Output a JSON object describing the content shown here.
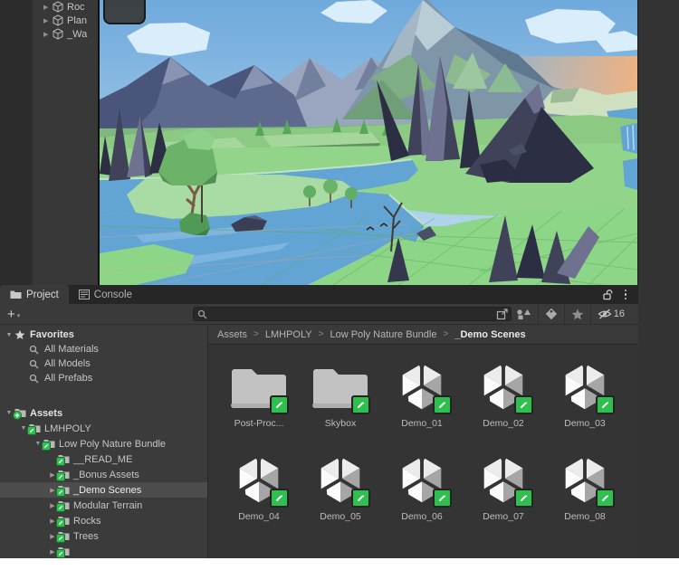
{
  "hierarchy": {
    "items": [
      {
        "label": "Roc"
      },
      {
        "label": "Plan"
      },
      {
        "label": "_Wa"
      }
    ]
  },
  "scene_view": {
    "palette": {
      "sky_top": "#6fa9dc",
      "sky_horizon": "#c3e0f0",
      "sunset": "#f2b27e",
      "cloud": "#d9edfb",
      "mountain_far": "#9aa6bf",
      "mountain_far_shadow": "#73809d",
      "mountain_dark": "#5d6a8e",
      "mountain_dark_shadow": "#49557a",
      "mountain_dark_light": "#8894b1",
      "peak": "#7f96a8",
      "peak_light": "#b9cdd6",
      "peak_green": "#7fae85",
      "cliff_pale": "#cfe0c0",
      "terrain": "#8cc983",
      "terrain_mid": "#92d489",
      "terrain_bright": "#8ed687",
      "island": "#a9dba5",
      "terrace_face": "#6f9e66",
      "water": "#62a4d4",
      "water_light": "#7cb5e0",
      "shore": "#bfe4c0",
      "crystal": "#3f4259",
      "crystal_light": "#6e7290",
      "crystal_dark": "#2c2e44",
      "tree": "#6db269",
      "tree_light": "#8ed18a",
      "tree_dark": "#4e8f52",
      "trunk": "#7a5a42",
      "grid_line": "#5fae63",
      "water_grid": "#d8a390"
    }
  },
  "project_panel": {
    "tabs": [
      {
        "label": "Project",
        "active": true
      },
      {
        "label": "Console",
        "active": false
      }
    ],
    "toolbar": {
      "create_label": "+",
      "search_placeholder": "",
      "hidden_count": "16"
    },
    "favorites": {
      "label": "Favorites",
      "items": [
        "All Materials",
        "All Models",
        "All Prefabs"
      ]
    },
    "assets_tree": [
      {
        "label": "Assets",
        "depth": 0,
        "arrow": "down",
        "badge": "plus",
        "bold": true,
        "selected": false
      },
      {
        "label": "LMHPOLY",
        "depth": 1,
        "arrow": "down",
        "badge": "pencil",
        "bold": false,
        "selected": false
      },
      {
        "label": "Low Poly Nature Bundle",
        "depth": 2,
        "arrow": "down",
        "badge": "pencil",
        "bold": false,
        "selected": false
      },
      {
        "label": "__READ_ME",
        "depth": 3,
        "arrow": "none",
        "badge": "pencil",
        "bold": false,
        "selected": false
      },
      {
        "label": "_Bonus Assets",
        "depth": 3,
        "arrow": "right",
        "badge": "pencil",
        "bold": false,
        "selected": false
      },
      {
        "label": "_Demo Scenes",
        "depth": 3,
        "arrow": "right",
        "badge": "pencil",
        "bold": false,
        "selected": true
      },
      {
        "label": "Modular Terrain",
        "depth": 3,
        "arrow": "right",
        "badge": "pencil",
        "bold": false,
        "selected": false
      },
      {
        "label": "Rocks",
        "depth": 3,
        "arrow": "right",
        "badge": "pencil",
        "bold": false,
        "selected": false
      },
      {
        "label": "Trees",
        "depth": 3,
        "arrow": "right",
        "badge": "pencil",
        "bold": false,
        "selected": false
      }
    ],
    "breadcrumb": {
      "segments": [
        "Assets",
        "LMHPOLY",
        "Low Poly Nature Bundle",
        "_Demo Scenes"
      ],
      "separator": ">"
    },
    "grid": {
      "items": [
        {
          "label": "Post-Proc...",
          "type": "folder"
        },
        {
          "label": "Skybox",
          "type": "folder"
        },
        {
          "label": "Demo_01",
          "type": "scene"
        },
        {
          "label": "Demo_02",
          "type": "scene"
        },
        {
          "label": "Demo_03",
          "type": "scene"
        },
        {
          "label": "Demo_04",
          "type": "scene"
        },
        {
          "label": "Demo_05",
          "type": "scene"
        },
        {
          "label": "Demo_06",
          "type": "scene"
        },
        {
          "label": "Demo_07",
          "type": "scene"
        },
        {
          "label": "Demo_08",
          "type": "scene"
        }
      ]
    }
  }
}
